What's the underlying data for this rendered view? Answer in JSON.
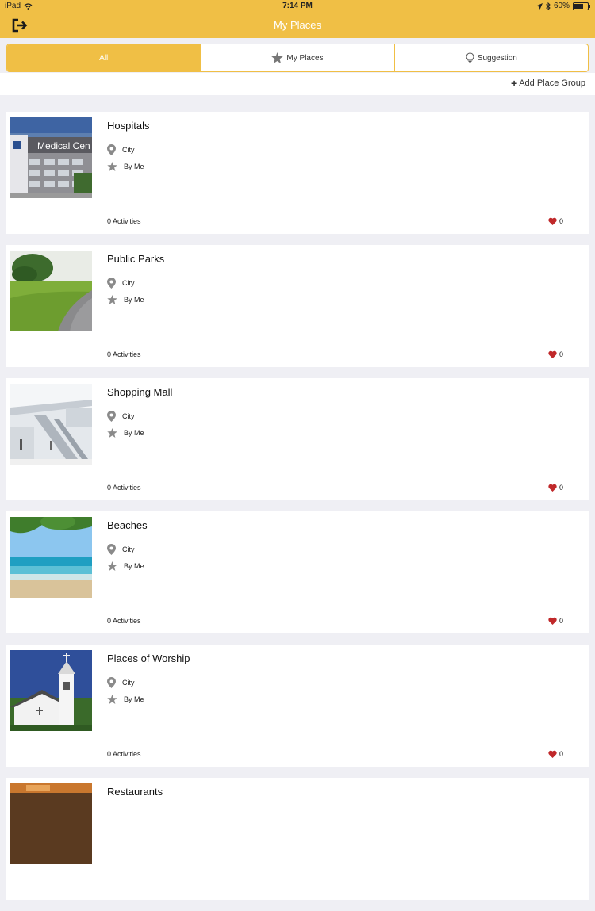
{
  "status": {
    "device": "iPad",
    "time": "7:14 PM",
    "battery": "60%"
  },
  "nav": {
    "title": "My Places"
  },
  "tabs": [
    {
      "label": "All",
      "active": true,
      "icon": ""
    },
    {
      "label": "My Places",
      "active": false,
      "icon": "star-icon"
    },
    {
      "label": "Suggestion",
      "active": false,
      "icon": "lightbulb-icon"
    }
  ],
  "actions": {
    "add_place_group": "Add Place Group"
  },
  "colors": {
    "accent": "#f0bf45",
    "heart": "#c0282a",
    "icon_gray": "#8a8a8a"
  },
  "places": [
    {
      "title": "Hospitals",
      "location": "City",
      "creator": "By Me",
      "activities": "0 Activities",
      "likes": "0",
      "image_text": "Medical Cen"
    },
    {
      "title": "Public Parks",
      "location": "City",
      "creator": "By Me",
      "activities": "0 Activities",
      "likes": "0"
    },
    {
      "title": "Shopping Mall",
      "location": "City",
      "creator": "By Me",
      "activities": "0 Activities",
      "likes": "0"
    },
    {
      "title": "Beaches",
      "location": "City",
      "creator": "By Me",
      "activities": "0 Activities",
      "likes": "0"
    },
    {
      "title": "Places of Worship",
      "location": "City",
      "creator": "By Me",
      "activities": "0 Activities",
      "likes": "0"
    },
    {
      "title": "Restaurants"
    }
  ]
}
